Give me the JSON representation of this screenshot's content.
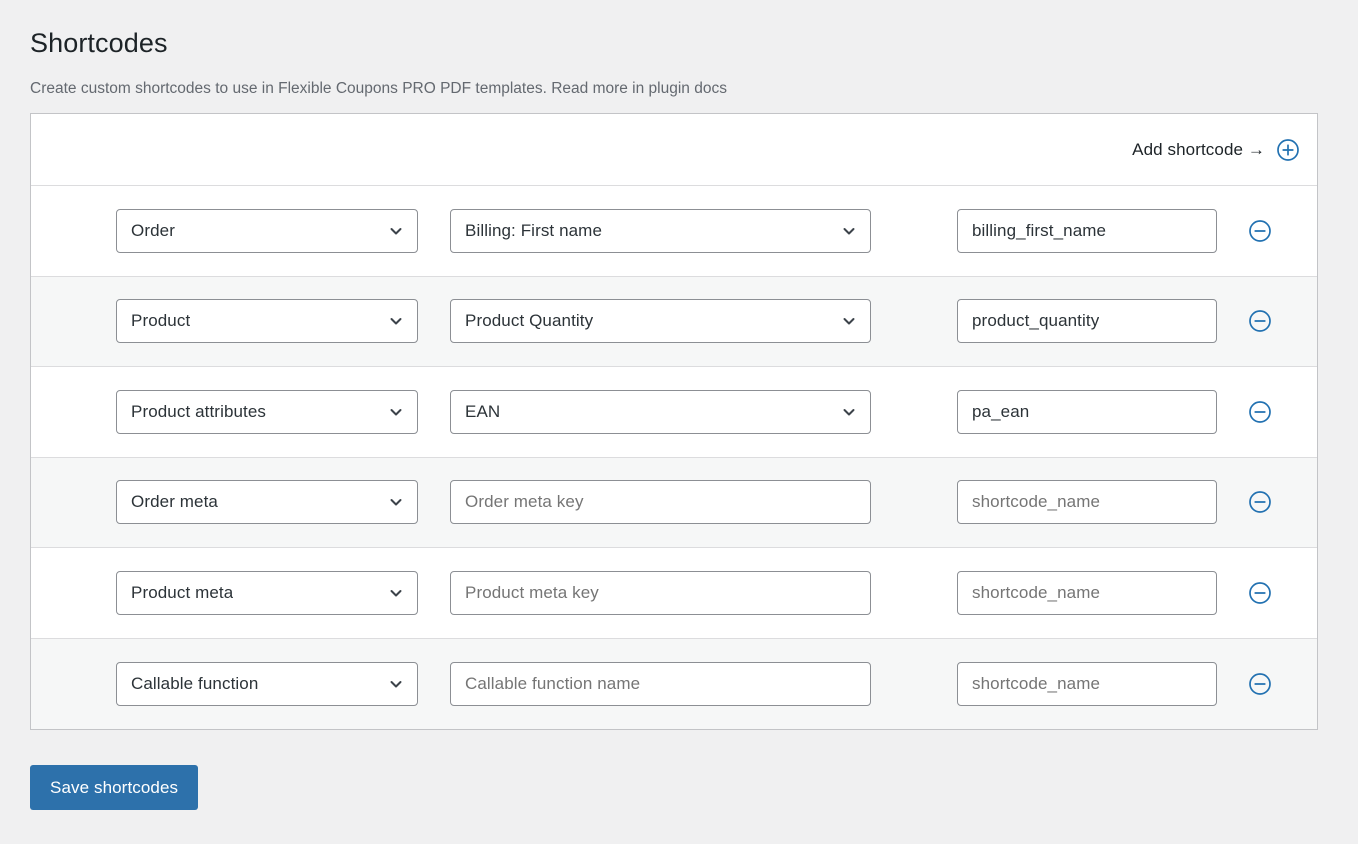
{
  "page": {
    "title": "Shortcodes",
    "description": "Create custom shortcodes to use in Flexible Coupons PRO PDF templates. Read more in plugin docs"
  },
  "colors": {
    "accent": "#2271b1",
    "button_bg": "#2d71ab",
    "page_bg": "#f0f0f1",
    "card_border": "#c3c4c7",
    "row_stripe": "#f6f7f7",
    "placeholder_text": "#757575"
  },
  "card_header": {
    "add_label": "Add shortcode →",
    "add_icon": "plus-circle-icon"
  },
  "rows": [
    {
      "source": {
        "type": "select",
        "value": "Order",
        "icon": "chevron-down-icon"
      },
      "key": {
        "type": "select",
        "value": "Billing: First name",
        "icon": "chevron-down-icon"
      },
      "name": {
        "type": "input",
        "value": "billing_first_name",
        "placeholder": ""
      },
      "remove_icon": "minus-circle-icon"
    },
    {
      "source": {
        "type": "select",
        "value": "Product",
        "icon": "chevron-down-icon"
      },
      "key": {
        "type": "select",
        "value": "Product Quantity",
        "icon": "chevron-down-icon"
      },
      "name": {
        "type": "input",
        "value": "product_quantity",
        "placeholder": ""
      },
      "remove_icon": "minus-circle-icon"
    },
    {
      "source": {
        "type": "select",
        "value": "Product attributes",
        "icon": "chevron-down-icon"
      },
      "key": {
        "type": "select",
        "value": "EAN",
        "icon": "chevron-down-icon"
      },
      "name": {
        "type": "input",
        "value": "pa_ean",
        "placeholder": ""
      },
      "remove_icon": "minus-circle-icon"
    },
    {
      "source": {
        "type": "select",
        "value": "Order meta",
        "icon": "chevron-down-icon"
      },
      "key": {
        "type": "input",
        "value": "",
        "placeholder": "Order meta key"
      },
      "name": {
        "type": "input",
        "value": "",
        "placeholder": "shortcode_name"
      },
      "remove_icon": "minus-circle-icon"
    },
    {
      "source": {
        "type": "select",
        "value": "Product meta",
        "icon": "chevron-down-icon"
      },
      "key": {
        "type": "input",
        "value": "",
        "placeholder": "Product meta key"
      },
      "name": {
        "type": "input",
        "value": "",
        "placeholder": "shortcode_name"
      },
      "remove_icon": "minus-circle-icon"
    },
    {
      "source": {
        "type": "select",
        "value": "Callable function",
        "icon": "chevron-down-icon"
      },
      "key": {
        "type": "input",
        "value": "",
        "placeholder": "Callable function name"
      },
      "name": {
        "type": "input",
        "value": "",
        "placeholder": "shortcode_name"
      },
      "remove_icon": "minus-circle-icon"
    }
  ],
  "footer": {
    "save_label": "Save shortcodes"
  }
}
